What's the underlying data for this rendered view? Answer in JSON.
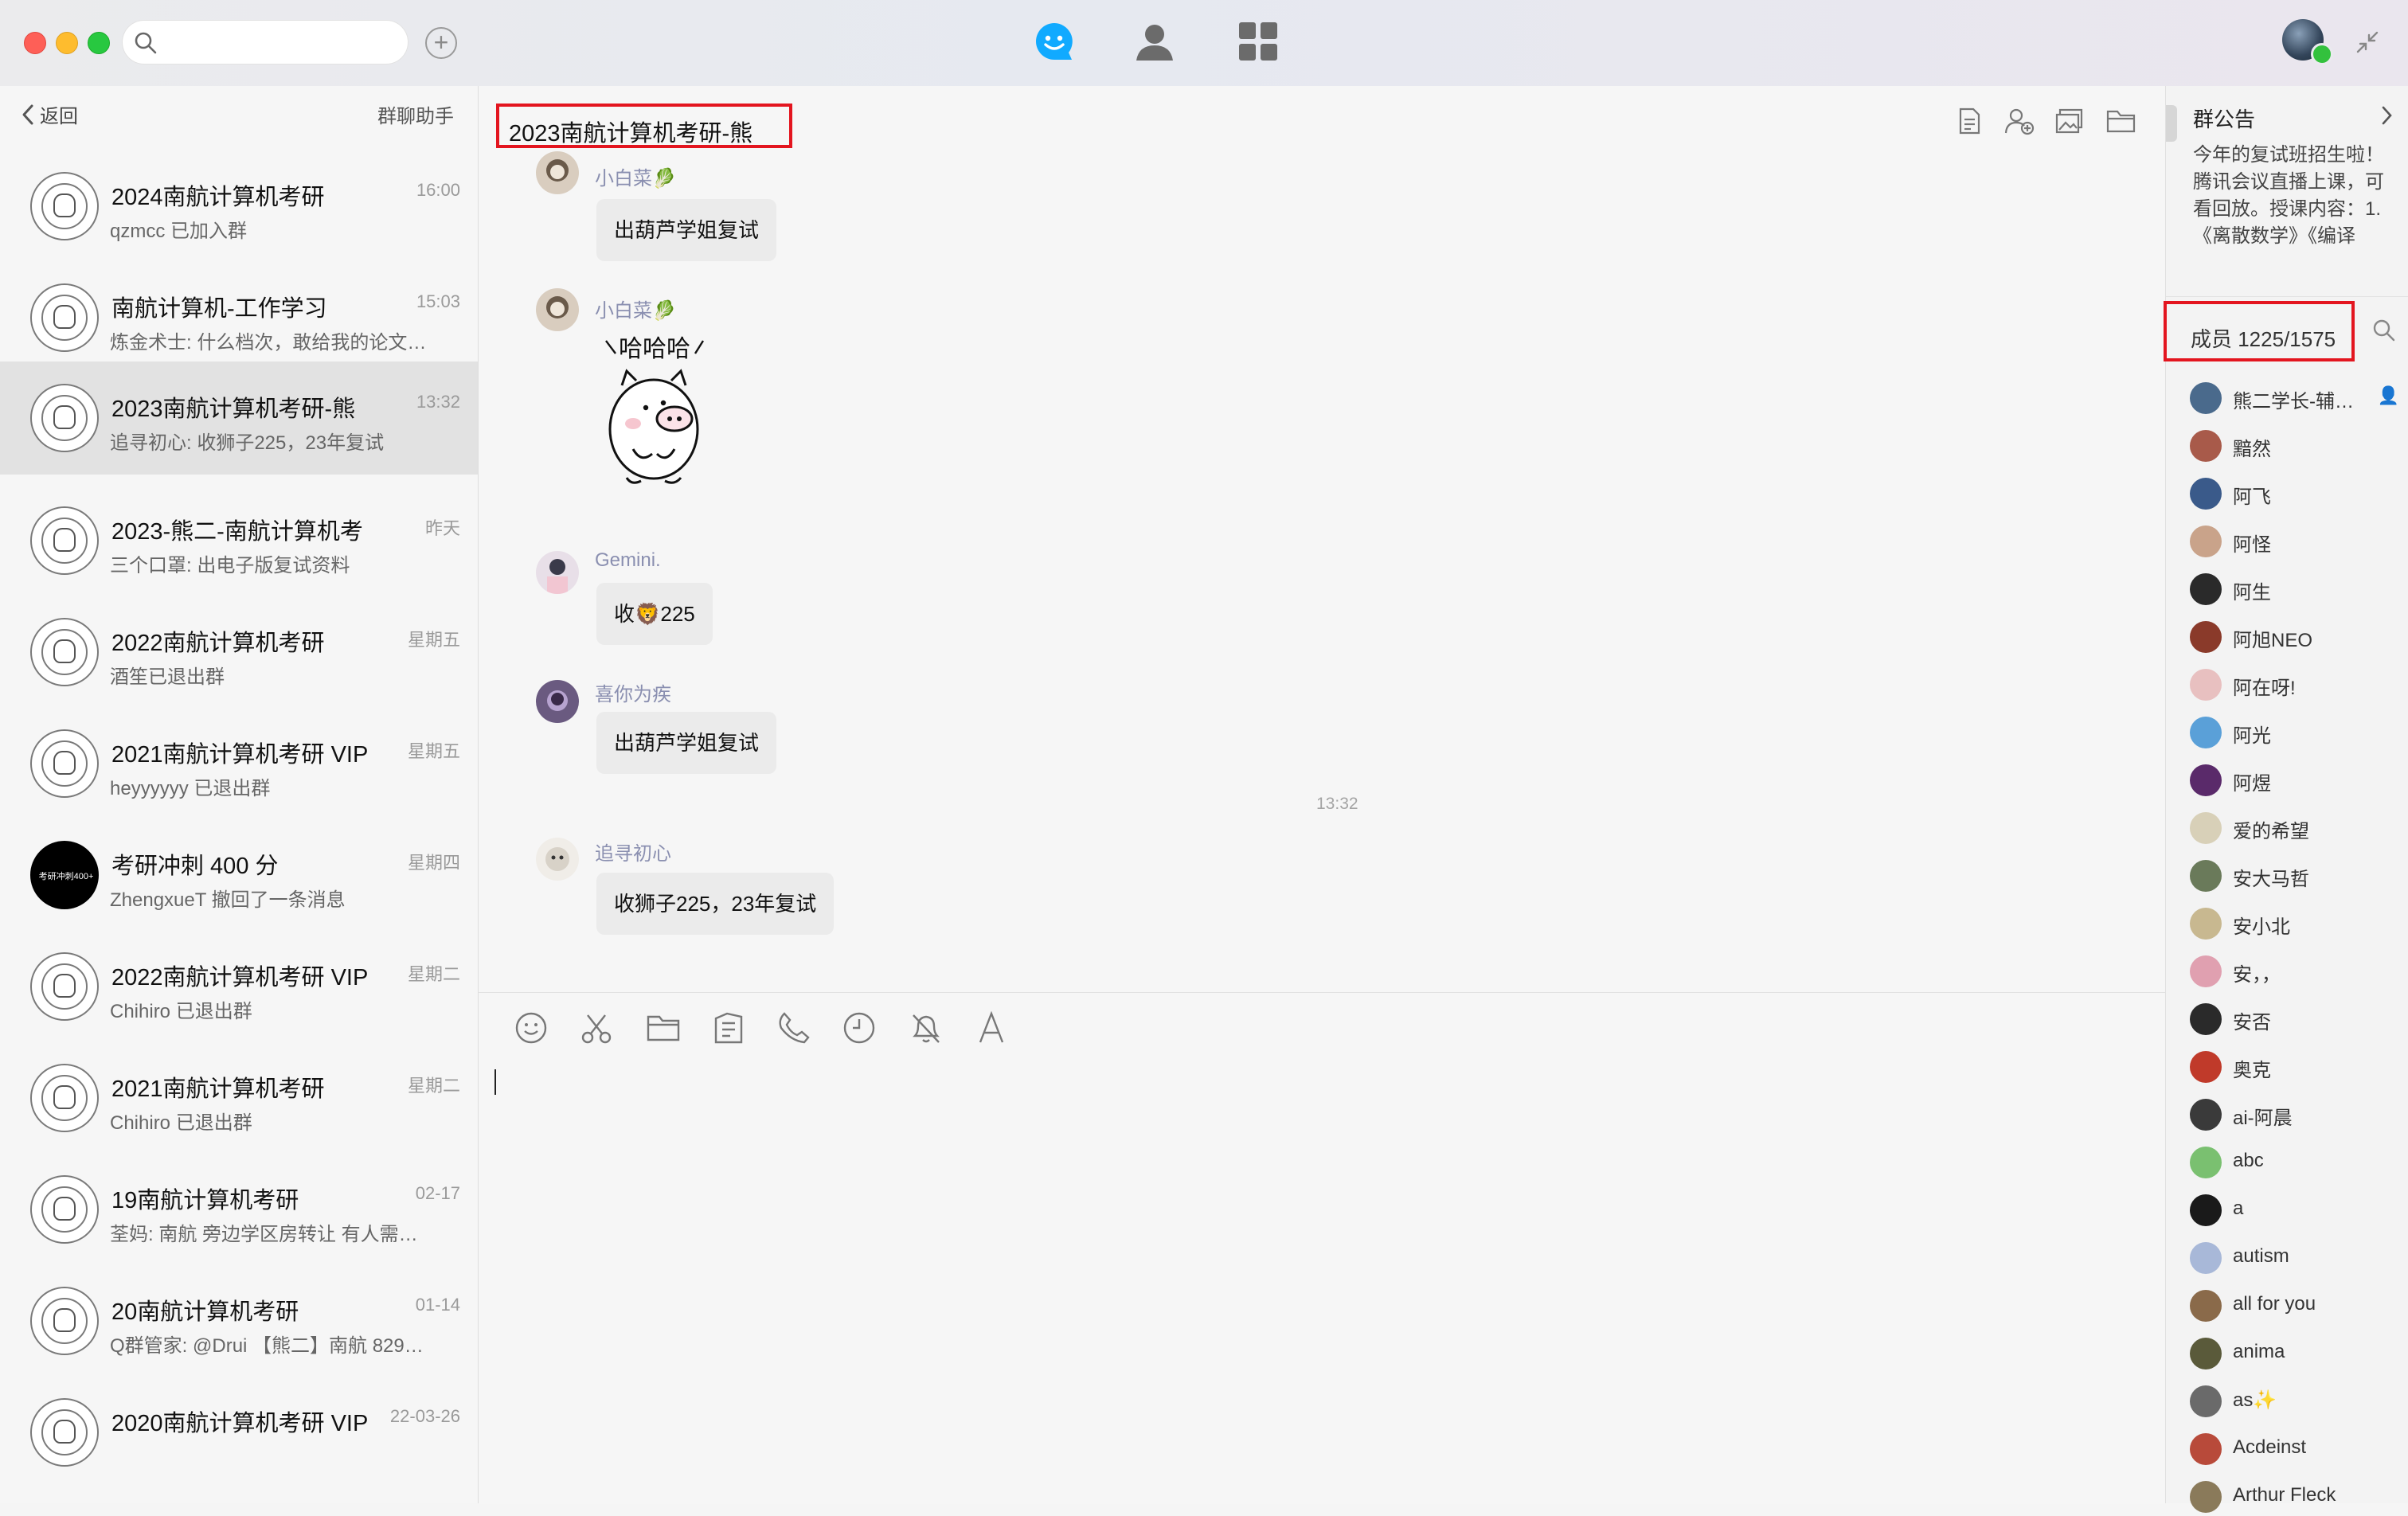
{
  "window": {
    "search_placeholder": "",
    "nav_icons": [
      "chat-icon",
      "contacts-icon",
      "apps-grid-icon"
    ]
  },
  "sidebar": {
    "back_label": "返回",
    "helper_label": "群聊助手",
    "conversations": [
      {
        "name": "2024南航计算机考研",
        "preview": "qzmcc 已加入群",
        "time": "16:00"
      },
      {
        "name": "南航计算机-工作学习",
        "preview": "炼金术士: 什么档次，敢给我的论文…",
        "time": "15:03"
      },
      {
        "name": "2023南航计算机考研-熊",
        "preview": "追寻初心: 收狮子225，23年复试",
        "time": "13:32"
      },
      {
        "name": "2023-熊二-南航计算机考",
        "preview": "三个口罩: 出电子版复试资料",
        "time": "昨天"
      },
      {
        "name": "2022南航计算机考研",
        "preview": "酒笙已退出群",
        "time": "星期五"
      },
      {
        "name": "2021南航计算机考研 VIP",
        "preview": "heyyyyyy 已退出群",
        "time": "星期五"
      },
      {
        "name": "考研冲刺 400 分",
        "preview": "ZhengxueT 撤回了一条消息",
        "time": "星期四",
        "avatar_text": "考研冲刺400+"
      },
      {
        "name": "2022南航计算机考研 VIP",
        "preview": "Chihiro 已退出群",
        "time": "星期二"
      },
      {
        "name": "2021南航计算机考研",
        "preview": "Chihiro 已退出群",
        "time": "星期二"
      },
      {
        "name": "19南航计算机考研",
        "preview": "荃妈: 南航 旁边学区房转让 有人需…",
        "time": "02-17"
      },
      {
        "name": "20南航计算机考研",
        "preview": "Q群管家: @Drui 【熊二】南航 829…",
        "time": "01-14"
      },
      {
        "name": "2020南航计算机考研 VIP",
        "preview": "",
        "time": "22-03-26"
      }
    ]
  },
  "chat": {
    "title": "2023南航计算机考研-熊",
    "header_icons": [
      "announcement-icon",
      "add-member-icon",
      "album-icon",
      "folder-icon"
    ],
    "messages": [
      {
        "sender": "小白菜🥬",
        "text": "出葫芦学姐复试"
      },
      {
        "sender": "小白菜🥬",
        "sticker_text": "哈哈哈"
      },
      {
        "sender": "Gemini.",
        "text": "收🦁225"
      },
      {
        "sender": "喜你为疾",
        "text": "出葫芦学姐复试"
      },
      {
        "sender": "追寻初心",
        "text": "收狮子225，23年复试"
      }
    ],
    "time_separator": "13:32",
    "toolbar_icons": [
      "emoji-icon",
      "scissors-icon",
      "folder-icon",
      "screenshot-icon",
      "phone-icon",
      "clock-icon",
      "mute-bell-icon",
      "font-icon"
    ]
  },
  "right_panel": {
    "announcement_title": "群公告",
    "announcement_text": "今年的复试班招生啦！腾讯会议直播上课，可看回放。授课内容：1.《离散数学》《编译",
    "member_count": "成员 1225/1575",
    "members": [
      {
        "name": "熊二学长-辅…",
        "color": "#4a6a8c"
      },
      {
        "name": "黯然",
        "color": "#a85a4a"
      },
      {
        "name": "阿飞",
        "color": "#3a5a8a"
      },
      {
        "name": "阿怪",
        "color": "#c9a38a"
      },
      {
        "name": "阿生",
        "color": "#2a2a2a"
      },
      {
        "name": "阿旭NEO",
        "color": "#8a3a2a"
      },
      {
        "name": "阿在呀!",
        "color": "#e8c0c0"
      },
      {
        "name": "阿光",
        "color": "#5aa0d8"
      },
      {
        "name": "阿煜",
        "color": "#5a2a6a"
      },
      {
        "name": "爱的希望",
        "color": "#d8d0b8"
      },
      {
        "name": "安大马哲",
        "color": "#6a7a5a"
      },
      {
        "name": "安小北",
        "color": "#c8b890"
      },
      {
        "name": "安，，",
        "color": "#e0a0b0"
      },
      {
        "name": "安否",
        "color": "#2a2a2a"
      },
      {
        "name": "奥克",
        "color": "#c03a2a"
      },
      {
        "name": "ai-阿晨",
        "color": "#3a3a3a"
      },
      {
        "name": "abc",
        "color": "#7ac070"
      },
      {
        "name": "a",
        "color": "#1a1a1a"
      },
      {
        "name": "autism",
        "color": "#a8b8d8"
      },
      {
        "name": "all  for  you",
        "color": "#8a6a4a"
      },
      {
        "name": "anima",
        "color": "#5a5a3a"
      },
      {
        "name": "as✨",
        "color": "#6a6a6a"
      },
      {
        "name": "Acdeinst",
        "color": "#b84a3a"
      },
      {
        "name": "Arthur Fleck",
        "color": "#8a7a5a"
      }
    ]
  }
}
